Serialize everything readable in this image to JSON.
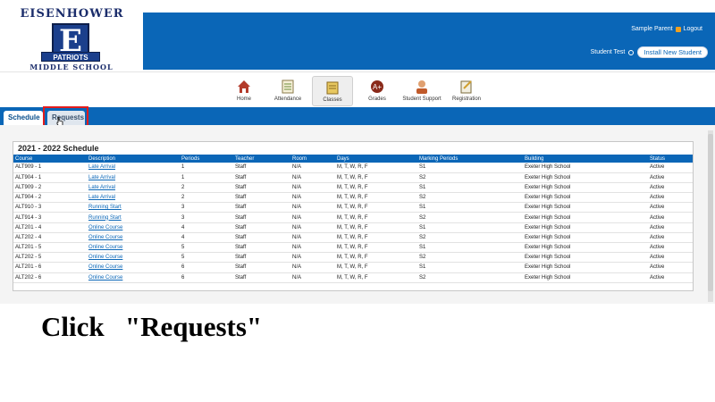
{
  "header": {
    "logo": {
      "top": "EISENHOWER",
      "letter": "E",
      "banner": "PATRIOTS",
      "bottom": "MIDDLE SCHOOL"
    },
    "user_name": "Sample Parent",
    "logout_label": "Logout",
    "student_name": "Student Test",
    "install_label": "Install New Student"
  },
  "nav": {
    "items": [
      {
        "label": "Home",
        "icon": "home-icon"
      },
      {
        "label": "Attendance",
        "icon": "attendance-icon"
      },
      {
        "label": "Classes",
        "icon": "classes-icon",
        "active": true
      },
      {
        "label": "Grades",
        "icon": "grades-icon"
      },
      {
        "label": "Student Support",
        "icon": "student-support-icon"
      },
      {
        "label": "Registration",
        "icon": "registration-icon"
      }
    ]
  },
  "tabs": {
    "schedule": "Schedule",
    "requests": "Requests"
  },
  "schedule": {
    "title": "2021 - 2022 Schedule",
    "columns": [
      "Course",
      "Description",
      "Periods",
      "Teacher",
      "Room",
      "Days",
      "Marking Periods",
      "Building",
      "Status"
    ],
    "rows": [
      [
        "ALT909 - 1",
        "Late Arrival",
        "1",
        "Staff",
        "N/A",
        "M, T, W, R, F",
        "S1",
        "Exeter High School",
        "Active"
      ],
      [
        "ALT904 - 1",
        "Late Arrival",
        "1",
        "Staff",
        "N/A",
        "M, T, W, R, F",
        "S2",
        "Exeter High School",
        "Active"
      ],
      [
        "ALT909 - 2",
        "Late Arrival",
        "2",
        "Staff",
        "N/A",
        "M, T, W, R, F",
        "S1",
        "Exeter High School",
        "Active"
      ],
      [
        "ALT904 - 2",
        "Late Arrival",
        "2",
        "Staff",
        "N/A",
        "M, T, W, R, F",
        "S2",
        "Exeter High School",
        "Active"
      ],
      [
        "ALT910 - 3",
        "Running Start",
        "3",
        "Staff",
        "N/A",
        "M, T, W, R, F",
        "S1",
        "Exeter High School",
        "Active"
      ],
      [
        "ALT914 - 3",
        "Running Start",
        "3",
        "Staff",
        "N/A",
        "M, T, W, R, F",
        "S2",
        "Exeter High School",
        "Active"
      ],
      [
        "ALT201 - 4",
        "Online Course",
        "4",
        "Staff",
        "N/A",
        "M, T, W, R, F",
        "S1",
        "Exeter High School",
        "Active"
      ],
      [
        "ALT202 - 4",
        "Online Course",
        "4",
        "Staff",
        "N/A",
        "M, T, W, R, F",
        "S2",
        "Exeter High School",
        "Active"
      ],
      [
        "ALT201 - 5",
        "Online Course",
        "5",
        "Staff",
        "N/A",
        "M, T, W, R, F",
        "S1",
        "Exeter High School",
        "Active"
      ],
      [
        "ALT202 - 5",
        "Online Course",
        "5",
        "Staff",
        "N/A",
        "M, T, W, R, F",
        "S2",
        "Exeter High School",
        "Active"
      ],
      [
        "ALT201 - 6",
        "Online Course",
        "6",
        "Staff",
        "N/A",
        "M, T, W, R, F",
        "S1",
        "Exeter High School",
        "Active"
      ],
      [
        "ALT202 - 6",
        "Online Course",
        "6",
        "Staff",
        "N/A",
        "M, T, W, R, F",
        "S2",
        "Exeter High School",
        "Active"
      ]
    ]
  },
  "instruction": "Click   \"Requests\"",
  "colors": {
    "brand_blue": "#0a66b7",
    "highlight_red": "#e21c1c"
  }
}
